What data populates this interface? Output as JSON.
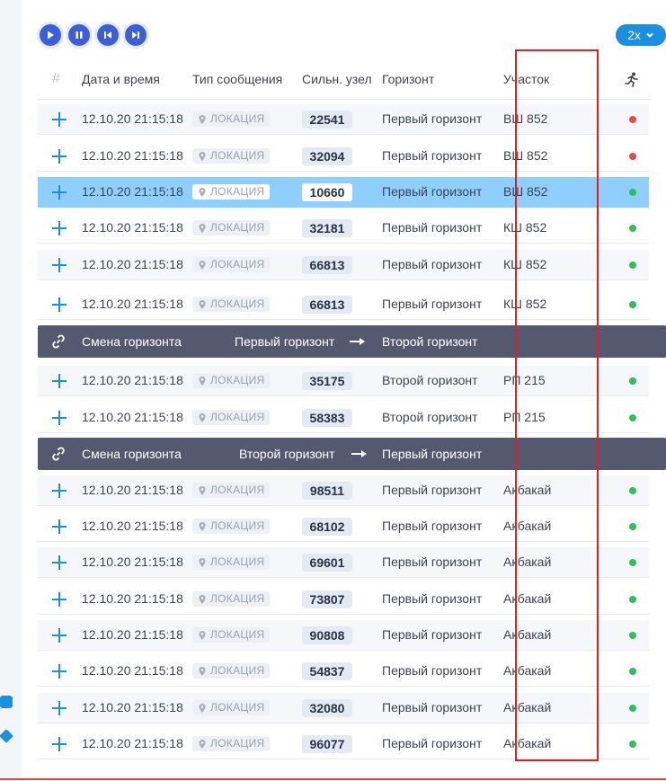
{
  "player": {
    "speed_label": "2x"
  },
  "columns": {
    "hash": "#",
    "datetime": "Дата и время",
    "msg_type": "Тип сообщения",
    "node": "Сильн. узел",
    "horizon": "Горизонт",
    "section": "Участок"
  },
  "colors": {
    "accent": "#1c8fe0",
    "control": "#3d5fd6",
    "band": "#55596f",
    "status_red": "#e5484d",
    "status_green": "#2fbf5a",
    "highlight": "#e02020"
  },
  "rows": [
    {
      "datetime": "12.10.20 21:15:18",
      "type": "ЛОКАЦИЯ",
      "node": "22541",
      "horizon": "Первый горизонт",
      "section": "ВШ 852",
      "status": "red"
    },
    {
      "datetime": "12.10.20 21:15:18",
      "type": "ЛОКАЦИЯ",
      "node": "32094",
      "horizon": "Первый горизонт",
      "section": "ВШ 852",
      "status": "red"
    },
    {
      "datetime": "12.10.20 21:15:18",
      "type": "ЛОКАЦИЯ",
      "node": "10660",
      "horizon": "Первый горизонт",
      "section": "ВШ 852",
      "status": "green"
    },
    {
      "datetime": "12.10.20 21:15:18",
      "type": "ЛОКАЦИЯ",
      "node": "32181",
      "horizon": "Первый горизонт",
      "section": "КШ 852",
      "status": "green"
    },
    {
      "datetime": "12.10.20 21:15:18",
      "type": "ЛОКАЦИЯ",
      "node": "66813",
      "horizon": "Первый горизонт",
      "section": "КШ 852",
      "status": "green"
    },
    {
      "datetime": "12.10.20 21:15:18",
      "type": "ЛОКАЦИЯ",
      "node": "66813",
      "horizon": "Первый горизонт",
      "section": "КШ 852",
      "status": "green"
    },
    {
      "datetime": "12.10.20 21:15:18",
      "type": "ЛОКАЦИЯ",
      "node": "35175",
      "horizon": "Второй горизонт",
      "section": "РП 215",
      "status": "green"
    },
    {
      "datetime": "12.10.20 21:15:18",
      "type": "ЛОКАЦИЯ",
      "node": "58383",
      "horizon": "Второй горизонт",
      "section": "РП 215",
      "status": "green"
    },
    {
      "datetime": "12.10.20 21:15:18",
      "type": "ЛОКАЦИЯ",
      "node": "98511",
      "horizon": "Первый горизонт",
      "section": "Акбакай",
      "status": "green"
    },
    {
      "datetime": "12.10.20 21:15:18",
      "type": "ЛОКАЦИЯ",
      "node": "68102",
      "horizon": "Первый горизонт",
      "section": "Акбакай",
      "status": "green"
    },
    {
      "datetime": "12.10.20 21:15:18",
      "type": "ЛОКАЦИЯ",
      "node": "69601",
      "horizon": "Первый горизонт",
      "section": "Акбакай",
      "status": "green"
    },
    {
      "datetime": "12.10.20 21:15:18",
      "type": "ЛОКАЦИЯ",
      "node": "73807",
      "horizon": "Первый горизонт",
      "section": "Акбакай",
      "status": "green"
    },
    {
      "datetime": "12.10.20 21:15:18",
      "type": "ЛОКАЦИЯ",
      "node": "90808",
      "horizon": "Первый горизонт",
      "section": "Акбакай",
      "status": "green"
    },
    {
      "datetime": "12.10.20 21:15:18",
      "type": "ЛОКАЦИЯ",
      "node": "54837",
      "horizon": "Первый горизонт",
      "section": "Акбакай",
      "status": "green"
    },
    {
      "datetime": "12.10.20 21:15:18",
      "type": "ЛОКАЦИЯ",
      "node": "32080",
      "horizon": "Первый горизонт",
      "section": "Акбакай",
      "status": "green"
    },
    {
      "datetime": "12.10.20 21:15:18",
      "type": "ЛОКАЦИЯ",
      "node": "96077",
      "horizon": "Первый горизонт",
      "section": "Акбакай",
      "status": "green"
    }
  ],
  "bands": [
    {
      "label": "Смена горизонта",
      "from": "Первый горизонт",
      "to": "Второй горизонт"
    },
    {
      "label": "Смена горизонта",
      "from": "Второй горизонт",
      "to": "Первый горизонт"
    }
  ]
}
